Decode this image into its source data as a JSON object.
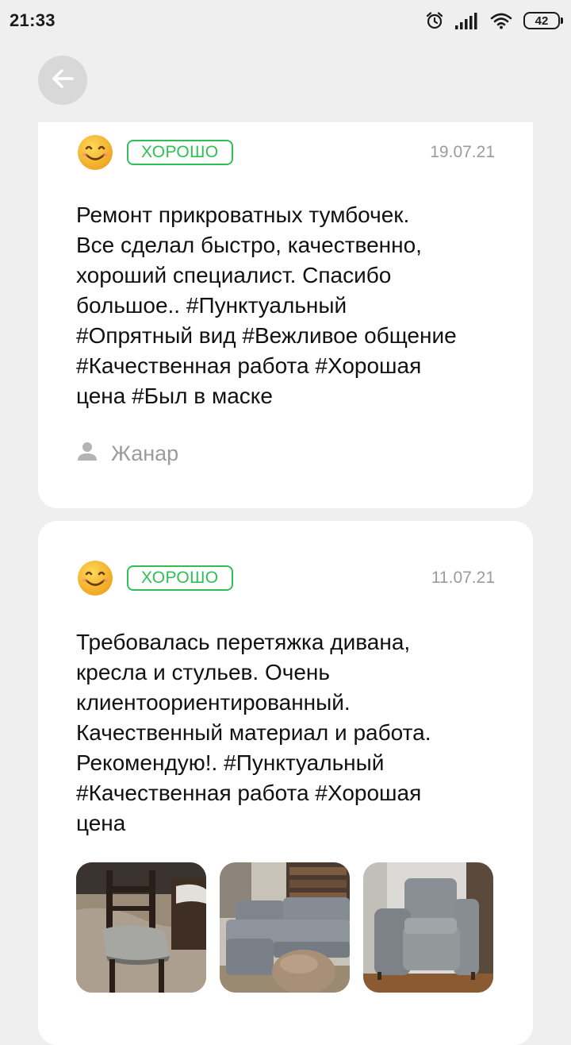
{
  "status_bar": {
    "time": "21:33",
    "battery": "42",
    "icons": [
      "alarm-icon",
      "signal-icon",
      "wifi-icon",
      "battery-icon"
    ]
  },
  "nav": {
    "back_icon": "arrow-left-icon"
  },
  "reviews": [
    {
      "rating_label": "ХОРОШО",
      "date": "19.07.21",
      "text": "Ремонт прикроватных тумбочек.\nВсе сделал быстро, качественно,\nхороший специалист. Спасибо\nбольшое..  #Пунктуальный\n#Опрятный вид #Вежливое общение\n#Качественная работа #Хорошая\nцена #Был в маске",
      "author": "Жанар"
    },
    {
      "rating_label": "ХОРОШО",
      "date": "11.07.21",
      "text": "Требовалась перетяжка дивана,\nкресла и стульев. Очень\nклиентоориентированный.\nКачественный материал и работа.\nРекомендую!.  #Пунктуальный\n#Качественная работа #Хорошая\nцена",
      "photos": [
        "chair-photo",
        "sofa-photo",
        "armchair-photo"
      ]
    }
  ],
  "colors": {
    "background": "#efefef",
    "card": "#ffffff",
    "badge_green": "#2fbf55",
    "muted_text": "#9b9b9b",
    "smiley_yellow": "#f5b52e"
  }
}
